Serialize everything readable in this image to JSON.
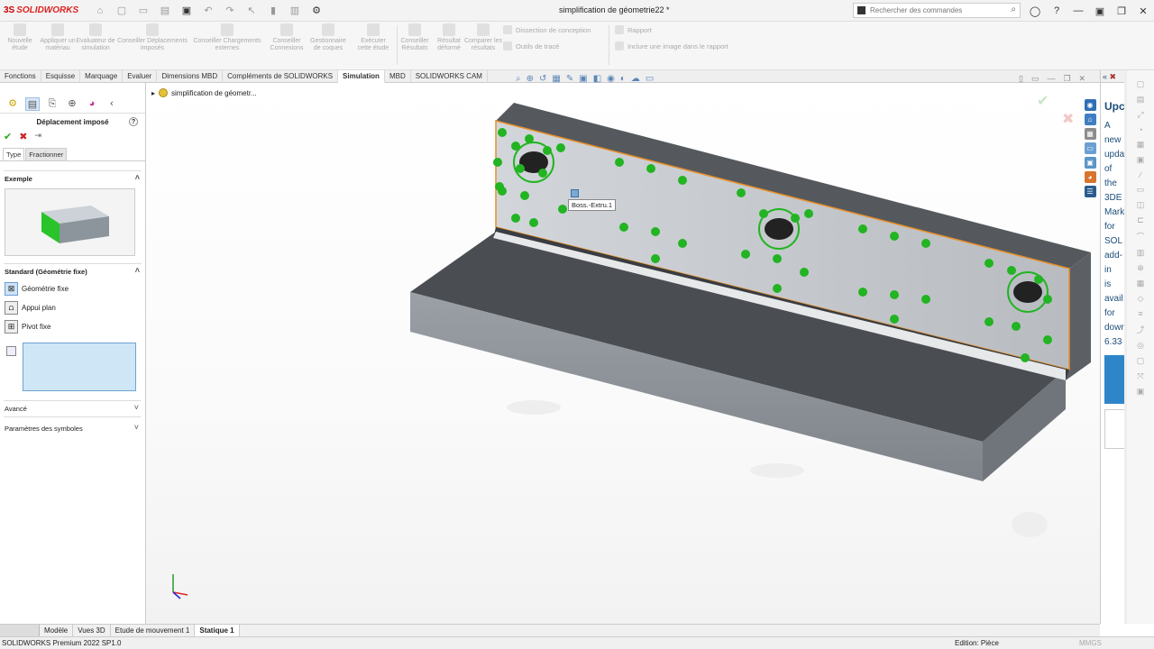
{
  "app": {
    "logo": "SOLIDWORKS",
    "document_title": "simplification de géometrie22 *",
    "search_placeholder": "Rechercher des commandes"
  },
  "ribbon": {
    "buttons": [
      {
        "label": "Nouvelle étude"
      },
      {
        "label": "Appliquer un matériau"
      },
      {
        "label": "Evaluateur de simulation"
      },
      {
        "label": "Conseiller Déplacements imposés"
      },
      {
        "label": "Conseiller Chargements externes"
      },
      {
        "label": "Conseiller Connexions"
      },
      {
        "label": "Gestionnaire de coques"
      },
      {
        "label": "Exécuter cette étude"
      },
      {
        "label": "Conseiller Résultats"
      },
      {
        "label": "Résultat déformé"
      },
      {
        "label": "Comparer les résultats"
      }
    ],
    "small": {
      "dissection": "Dissection de conception",
      "outils_trace": "Outils de tracé",
      "rapport": "Rapport",
      "inclure_image": "Inclure une image dans le rapport"
    }
  },
  "tabs": [
    {
      "label": "Fonctions"
    },
    {
      "label": "Esquisse"
    },
    {
      "label": "Marquage"
    },
    {
      "label": "Evaluer"
    },
    {
      "label": "Dimensions MBD"
    },
    {
      "label": "Compléments de SOLIDWORKS"
    },
    {
      "label": "Simulation"
    },
    {
      "label": "MBD"
    },
    {
      "label": "SOLIDWORKS CAM"
    }
  ],
  "property_manager": {
    "title": "Déplacement imposé",
    "subtabs": [
      "Type",
      "Fractionner"
    ],
    "exemple": "Exemple",
    "standard": "Standard (Géométrie fixe)",
    "options": [
      "Géométrie fixe",
      "Appui plan",
      "Pivot fixe"
    ],
    "avance": "Avancé",
    "parametres": "Paramètres des symboles"
  },
  "viewport": {
    "tree_item": "simplification de géometr...",
    "tooltip": "Boss.-Extru.1"
  },
  "taskpane": {
    "title": "Upc Ava",
    "text_lines": [
      "A",
      "new",
      "upda",
      "of",
      "the",
      "3DE",
      "Mark",
      "for",
      "SOL",
      "add-",
      "in",
      "is",
      "avail",
      "for",
      "dowr",
      "6.33"
    ]
  },
  "bottom_tabs": [
    {
      "label": "Modèle"
    },
    {
      "label": "Vues 3D"
    },
    {
      "label": "Etude de mouvement 1"
    },
    {
      "label": "Statique 1"
    }
  ],
  "status": {
    "product": "SOLIDWORKS Premium 2022 SP1.0",
    "mode": "Edition: Pièce",
    "units": "MMGS"
  },
  "colors": {
    "accent": "#2e86c8",
    "fixture_green": "#22b422",
    "edge_highlight": "#e8902a"
  }
}
